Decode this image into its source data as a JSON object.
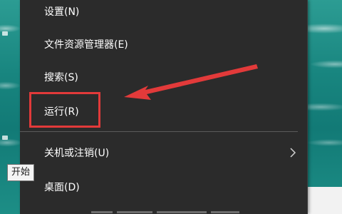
{
  "context_menu": {
    "items": [
      {
        "label": "设置(N)"
      },
      {
        "label": "文件资源管理器(E)"
      },
      {
        "label": "搜索(S)"
      },
      {
        "label": "运行(R)"
      },
      {
        "label": "关机或注销(U)",
        "has_submenu": true
      },
      {
        "label": "桌面(D)"
      }
    ]
  },
  "tooltip": {
    "text": "开始"
  },
  "annotation": {
    "color": "#e23a3a",
    "highlighted_item": "运行(R)"
  },
  "colors": {
    "menu_bg": "#2b2b2b",
    "menu_text": "#ffffff",
    "separator": "#5a5a5a"
  }
}
